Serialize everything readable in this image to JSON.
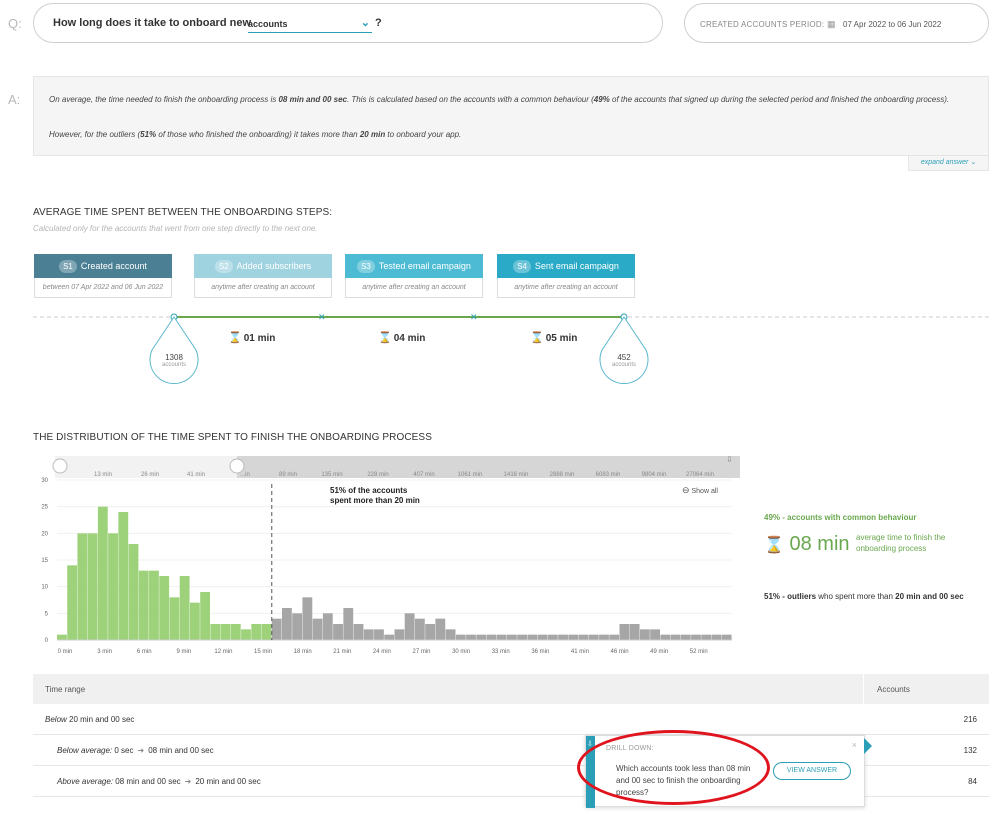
{
  "question": {
    "letter": "Q:",
    "text": "How long does it take to onboard new",
    "selected": "accounts",
    "suffix": "?"
  },
  "period": {
    "label": "CREATED ACCOUNTS PERIOD:",
    "icon": "calendar-icon",
    "value": "07 Apr 2022 to 06 Jun 2022"
  },
  "answer": {
    "letter": "A:",
    "p1_a": "On average, the time needed to finish the onboarding process is ",
    "p1_b": "08 min and 00 sec",
    "p1_c": ". This is calculated based on the accounts with a common behaviour (",
    "p1_d": "49%",
    "p1_e": " of the accounts that signed up during the selected period and finished the onboarding process).",
    "p2_a": "However, for the outliers (",
    "p2_b": "51%",
    "p2_c": " of those who finished the onboarding) it takes more than ",
    "p2_d": "20 min",
    "p2_e": " to onboard your app.",
    "expand": "expand answer ⌄"
  },
  "steps_section": {
    "title": "AVERAGE TIME SPENT BETWEEN THE ONBOARDING STEPS:",
    "subtitle": "Calculated only for the accounts that went from one step directly to the next one.",
    "steps": [
      {
        "num": "S1",
        "label": "Created account",
        "sub": "between 07 Apr 2022 and 06 Jun 2022",
        "color": "#4a7f94"
      },
      {
        "num": "S2",
        "label": "Added subscribers",
        "sub": "anytime after creating an account",
        "color": "#9fd3e0"
      },
      {
        "num": "S3",
        "label": "Tested email campaign",
        "sub": "anytime after creating an account",
        "color": "#4cbbd3"
      },
      {
        "num": "S4",
        "label": "Sent email campaign",
        "sub": "anytime after creating an account",
        "color": "#2aaac6"
      }
    ],
    "durations": [
      "01 min",
      "04 min",
      "05 min"
    ],
    "start_count": {
      "value": "1308",
      "unit": "accounts"
    },
    "end_count": {
      "value": "452",
      "unit": "accounts"
    }
  },
  "distribution": {
    "title": "THE DISTRIBUTION OF THE TIME SPENT TO FINISH THE ONBOARDING PROCESS",
    "top_ticks": [
      "13 min",
      "26 min",
      "41 min",
      "...in",
      "89 min",
      "135 min",
      "228 min",
      "407 min",
      "1061 min",
      "1416 min",
      "2888 min",
      "6083 min",
      "9804 min",
      "27064 min"
    ],
    "annotation_1": "51% of the accounts",
    "annotation_2": "spent more than 20  min",
    "show_all": "Show all",
    "common_label": "49% - accounts with common behaviour",
    "avg_time": "08 min",
    "avg_desc": "average time to finish the onboarding process",
    "outliers_a": "51% - outliers",
    "outliers_b": " who spent more than ",
    "outliers_c": "20 min and 00 sec"
  },
  "chart_data": {
    "type": "bar",
    "xlabel": "",
    "ylabel": "",
    "ylim": [
      0,
      30
    ],
    "yticks": [
      0,
      5,
      10,
      15,
      20,
      25,
      30
    ],
    "x_ticks": [
      "0 min",
      "3 min",
      "6 min",
      "9 min",
      "12 min",
      "15 min",
      "18 min",
      "21 min",
      "24 min",
      "27 min",
      "30 min",
      "33 min",
      "36 min",
      "41 min",
      "46 min",
      "49 min",
      "52 min"
    ],
    "threshold_index": 21,
    "green_color": "#9ed27a",
    "gray_color": "#a6a6a6",
    "values": [
      1,
      14,
      20,
      20,
      25,
      20,
      24,
      18,
      13,
      13,
      12,
      8,
      12,
      7,
      9,
      3,
      3,
      3,
      2,
      3,
      3,
      4,
      6,
      5,
      8,
      4,
      5,
      3,
      6,
      3,
      2,
      2,
      1,
      2,
      5,
      4,
      3,
      4,
      2,
      1,
      1,
      1,
      1,
      1,
      1,
      1,
      1,
      1,
      1,
      1,
      1,
      1,
      1,
      1,
      1,
      3,
      3,
      2,
      2,
      1,
      1,
      1,
      1,
      1,
      1,
      1
    ]
  },
  "table": {
    "header_range": "Time range",
    "header_accounts": "Accounts",
    "rows": [
      {
        "a": "Below ",
        "b": "20 min and 00 sec",
        "c": "",
        "value": "216"
      },
      {
        "a": "Below average:",
        "b": " 0 sec",
        "c": "08 min and 00 sec",
        "value": "132"
      },
      {
        "a": "Above average:",
        "b": " 08 min and 00 sec",
        "c": "20 min and 00 sec",
        "value": "84"
      }
    ]
  },
  "drill": {
    "title": "DRILL DOWN:",
    "question": "Which accounts took less than 08 min and 00 sec to finish the onboarding process?",
    "button": "VIEW ANSWER",
    "close": "×"
  }
}
